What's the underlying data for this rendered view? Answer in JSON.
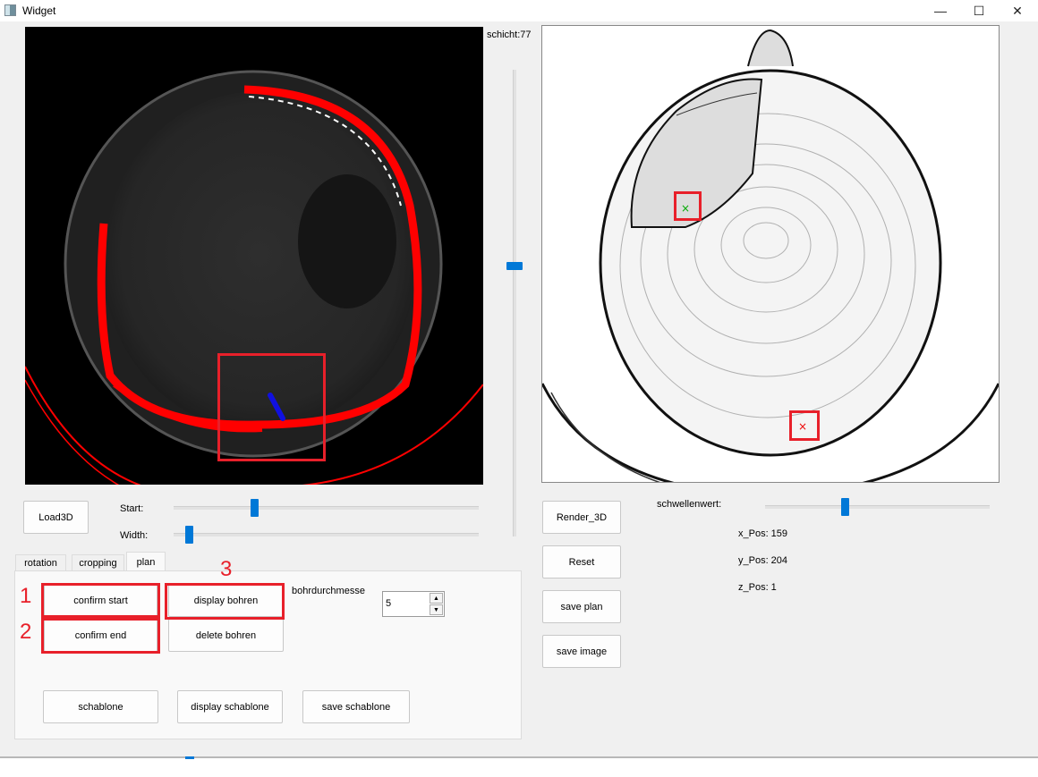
{
  "window": {
    "title": "Widget",
    "minimize": "—",
    "maximize": "☐",
    "close": "✕"
  },
  "slice": {
    "label": "schicht:77",
    "level": 0.58
  },
  "left_controls": {
    "load_label": "Load3D",
    "start_label": "Start:",
    "start_level": 0.26,
    "width_label": "Width:",
    "width_level": 0.04
  },
  "tabs": [
    {
      "label": "rotation"
    },
    {
      "label": "cropping"
    },
    {
      "label": "plan",
      "active": true
    }
  ],
  "plan": {
    "confirm_start": "confirm start",
    "confirm_end": "confirm end",
    "display_bohren": "display bohren",
    "delete_bohren": "delete bohren",
    "bohrdurchmesser_label": "bohrdurchmesse",
    "bohrdurchmesser_value": "5",
    "schablone": "schablone",
    "display_schablone": "display schablone",
    "save_schablone": "save schablone"
  },
  "annotations": {
    "n1": "1",
    "n2": "2",
    "n3": "3",
    "color": "#e8202a"
  },
  "right_controls": {
    "render": "Render_3D",
    "reset": "Reset",
    "save_plan": "save plan",
    "save_image": "save image",
    "threshold_label": "schwellenwert:",
    "threshold_level": 0.35,
    "x_pos": "x_Pos: 159",
    "y_pos": "y_Pos: 204",
    "z_pos": "z_Pos: 1"
  },
  "colors": {
    "accent": "#0078d7",
    "mask": "#ff0000",
    "probe": "#1010e0"
  }
}
